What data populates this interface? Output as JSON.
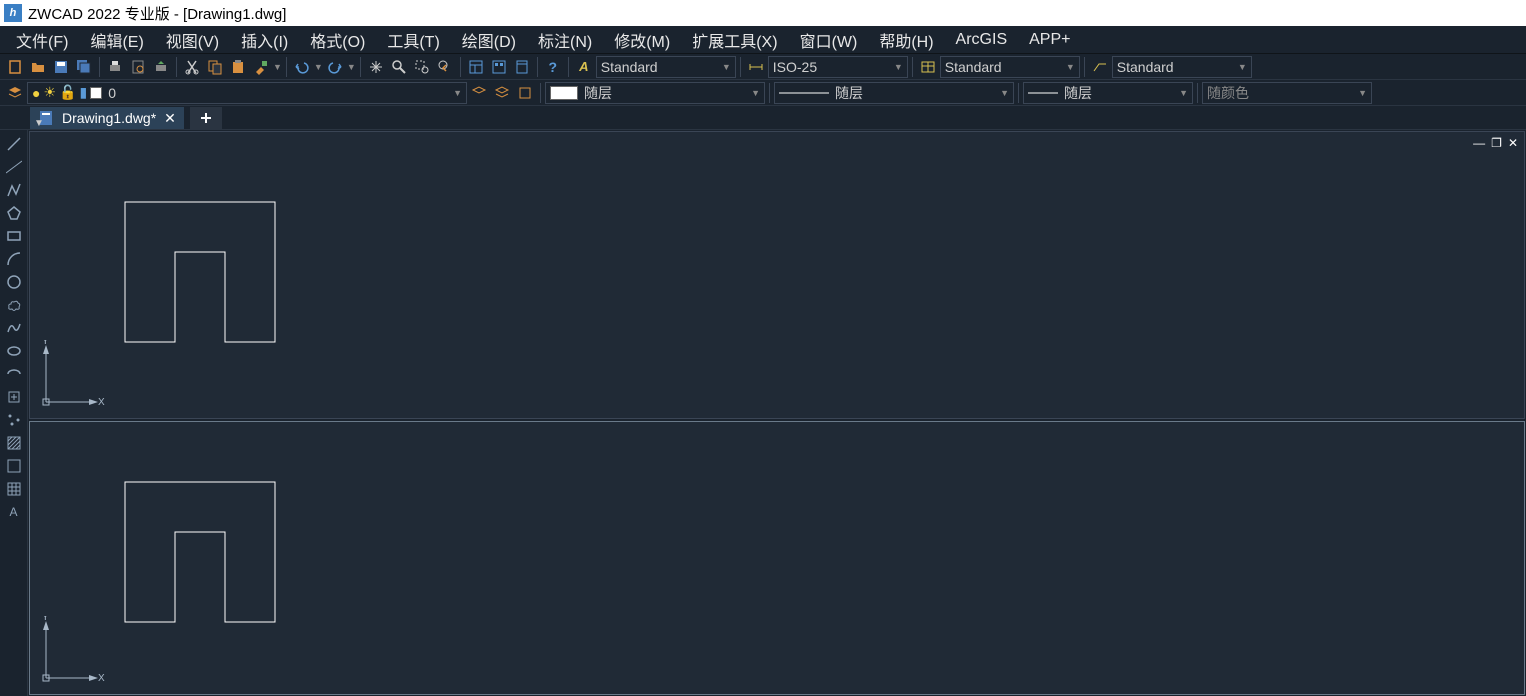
{
  "title_bar": {
    "app_name": "ZWCAD 2022 专业版 - [Drawing1.dwg]"
  },
  "menu": {
    "file": "文件(F)",
    "edit": "编辑(E)",
    "view": "视图(V)",
    "insert": "插入(I)",
    "format": "格式(O)",
    "tools": "工具(T)",
    "draw": "绘图(D)",
    "dim": "标注(N)",
    "modify": "修改(M)",
    "ext": "扩展工具(X)",
    "window": "窗口(W)",
    "help": "帮助(H)",
    "arcgis": "ArcGIS",
    "appplus": "APP+"
  },
  "styles": {
    "text": "Standard",
    "dim": "ISO-25",
    "table": "Standard",
    "mleader": "Standard"
  },
  "props": {
    "layer": "0",
    "color": "随层",
    "linetype": "随层",
    "lineweight": "随层",
    "plotstyle": "随颜色"
  },
  "tab": {
    "name": "Drawing1.dwg*"
  },
  "axes": {
    "x": "X",
    "y": "Y"
  }
}
